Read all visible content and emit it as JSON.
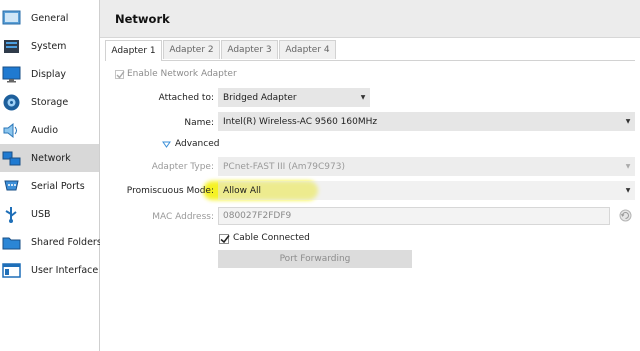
{
  "header": {
    "title": "Network"
  },
  "sidebar": {
    "items": [
      {
        "label": "General",
        "icon": "general-icon"
      },
      {
        "label": "System",
        "icon": "system-icon"
      },
      {
        "label": "Display",
        "icon": "display-icon"
      },
      {
        "label": "Storage",
        "icon": "storage-icon"
      },
      {
        "label": "Audio",
        "icon": "audio-icon"
      },
      {
        "label": "Network",
        "icon": "network-icon",
        "active": true
      },
      {
        "label": "Serial Ports",
        "icon": "serial-ports-icon"
      },
      {
        "label": "USB",
        "icon": "usb-icon"
      },
      {
        "label": "Shared Folders",
        "icon": "shared-folders-icon"
      },
      {
        "label": "User Interface",
        "icon": "user-interface-icon"
      }
    ]
  },
  "tabs": [
    {
      "label": "Adapter 1",
      "active": true
    },
    {
      "label": "Adapter 2"
    },
    {
      "label": "Adapter 3"
    },
    {
      "label": "Adapter 4"
    }
  ],
  "form": {
    "enable_adapter_label": "Enable Network Adapter",
    "enable_adapter_checked": true,
    "attached_to_label": "Attached to:",
    "attached_to_value": "Bridged Adapter",
    "name_label": "Name:",
    "name_value": "Intel(R) Wireless-AC 9560 160MHz",
    "advanced_label": "Advanced",
    "adapter_type_label": "Adapter Type:",
    "adapter_type_value": "PCnet-FAST III (Am79C973)",
    "promiscuous_label": "Promiscuous Mode:",
    "promiscuous_value": "Allow All",
    "mac_label": "MAC Address:",
    "mac_value": "080027F2FDF9",
    "cable_connected_label": "Cable Connected",
    "cable_connected_checked": true,
    "port_forwarding_label": "Port Forwarding"
  },
  "colors": {
    "highlight": "#f4f000",
    "active_sidebar": "#d8d8d8",
    "accent_icon_blue": "#1a6fb5"
  }
}
